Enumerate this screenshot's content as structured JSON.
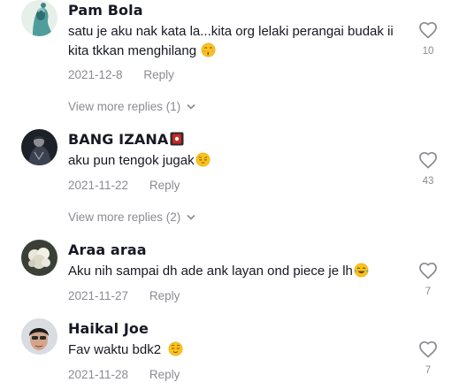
{
  "comments": [
    {
      "username": "Pam Bola",
      "text": "satu je aku nak kata la...kita org lelaki perangai budak ii kita tkkan menghilang",
      "emoji": "kissing-face-emoji",
      "date": "2021-12-8",
      "reply_label": "Reply",
      "likes": "10",
      "more_replies": "View more replies (1)"
    },
    {
      "username": "BANG IZANA",
      "badge": "playing-card-emoji",
      "text": "aku pun tengok jugak",
      "emoji": "pensive-face-emoji",
      "date": "2021-11-22",
      "reply_label": "Reply",
      "likes": "43",
      "more_replies": "View more replies (2)"
    },
    {
      "username": "Araa araa",
      "text": "Aku nih sampai dh ade ank layan ond piece je lh",
      "emoji": "tears-of-joy-emoji",
      "date": "2021-11-27",
      "reply_label": "Reply",
      "likes": "7"
    },
    {
      "username": "Haikal Joe",
      "text": "Fav waktu bdk2",
      "emoji": "relieved-face-emoji",
      "date": "2021-11-28",
      "reply_label": "Reply",
      "likes": "7"
    }
  ],
  "icons": {
    "like": "heart-outline-icon",
    "expand": "chevron-down-icon"
  },
  "colors": {
    "primary_text": "#161823",
    "secondary_text": "#8a8b91"
  }
}
